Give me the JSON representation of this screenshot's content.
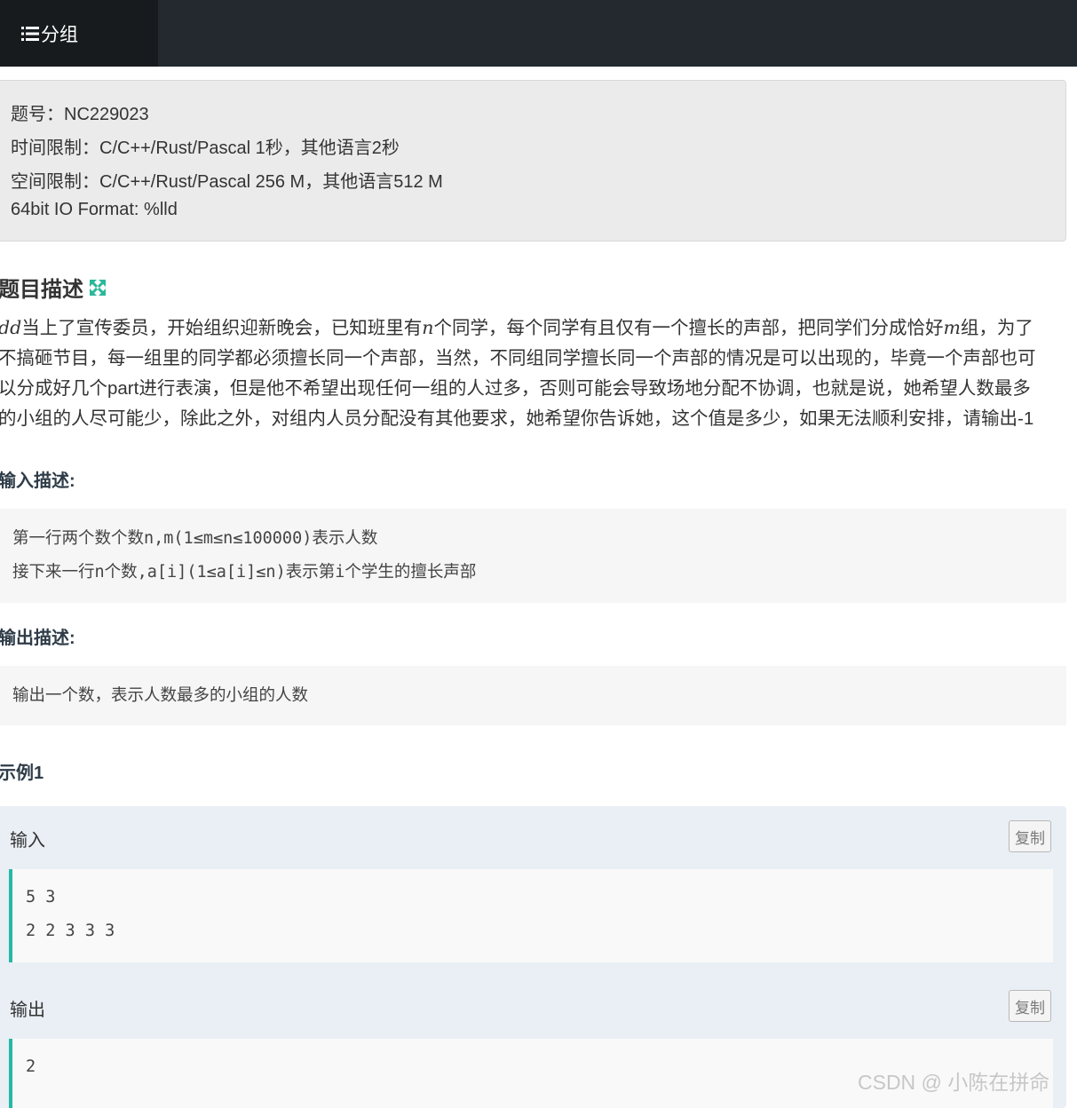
{
  "nav": {
    "active_tab": "分组",
    "icon": "list-icon"
  },
  "info": {
    "problem_id": "题号：NC229023",
    "time_limit": "时间限制：C/C++/Rust/Pascal 1秒，其他语言2秒",
    "memory_limit": "空间限制：C/C++/Rust/Pascal 256 M，其他语言512 M",
    "io_format": "64bit IO Format: %lld"
  },
  "description": {
    "title": "题目描述",
    "expand_icon": "expand-icon",
    "line1": {
      "var_d": "dd",
      "t1": "当上了宣传委员，开始组织迎新晚会，已知班里有",
      "var_n": "n",
      "t2": "个同学，每个同学有且仅有一个擅长的声部，把同学们分成恰好",
      "var_m": "m",
      "t3": "组，为了"
    },
    "line2": "不搞砸节目，每一组里的同学都必须擅长同一个声部，当然，不同组同学擅长同一个声部的情况是可以出现的，毕竟一个声部也可",
    "line3": "以分成好几个part进行表演，但是他不希望出现任何一组的人过多，否则可能会导致场地分配不协调，也就是说，她希望人数最多",
    "line4": "的小组的人尽可能少，除此之外，对组内人员分配没有其他要求，她希望你告诉她，这个值是多少，如果无法顺利安排，请输出-1"
  },
  "input_desc": {
    "title": "输入描述:",
    "lines": [
      "第一行两个数个数n,m(1≤m≤n≤100000)表示人数",
      "接下来一行n个数,a[i](1≤a[i]≤n)表示第i个学生的擅长声部"
    ]
  },
  "output_desc": {
    "title": "输出描述:",
    "lines": [
      "输出一个数，表示人数最多的小组的人数"
    ]
  },
  "example": {
    "title": "示例1",
    "input_label": "输入",
    "output_label": "输出",
    "copy_label": "复制",
    "input_lines": [
      "5 3",
      "2 2 3 3 3"
    ],
    "output_lines": [
      "2"
    ]
  },
  "watermark": "CSDN @ 小陈在拼命",
  "colors": {
    "nav_bg": "#23292e",
    "nav_active": "#171b1e",
    "accent": "#25b8a6",
    "example_bg": "#e9eff5"
  }
}
